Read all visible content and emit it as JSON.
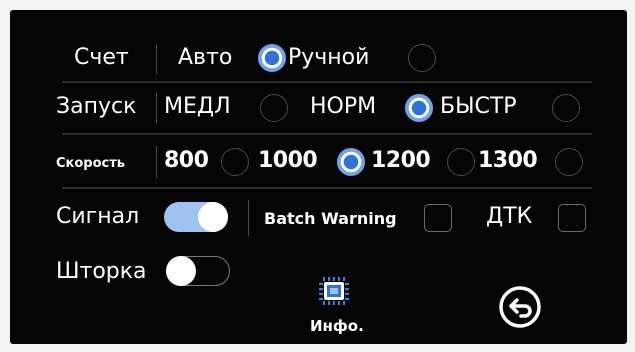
{
  "rows": {
    "count": {
      "label": "Счет",
      "options": [
        {
          "label": "Авто",
          "selected": true
        },
        {
          "label": "Ручной",
          "selected": false
        }
      ]
    },
    "start": {
      "label": "Запуск",
      "options": [
        {
          "label": "МЕДЛ",
          "selected": false
        },
        {
          "label": "НОРМ",
          "selected": true
        },
        {
          "label": "БЫСТР",
          "selected": false
        }
      ]
    },
    "speed": {
      "label": "Скорость",
      "options": [
        {
          "label": "800",
          "selected": false
        },
        {
          "label": "1000",
          "selected": true
        },
        {
          "label": "1200",
          "selected": false
        },
        {
          "label": "1300",
          "selected": false
        }
      ]
    },
    "signal": {
      "label": "Сигнал",
      "toggle_on": true,
      "batch_warning_label": "Batch Warning",
      "batch_warning_checked": false,
      "dtk_label": "ДТК",
      "dtk_checked": false
    },
    "curtain": {
      "label": "Шторка",
      "toggle_on": false
    }
  },
  "bottom": {
    "info_label": "Инфо.",
    "info_icon": "chip-icon",
    "back_icon": "return-icon"
  },
  "colors": {
    "screen_bg": "#050505",
    "accent": "#2f73d6",
    "accent_light": "#6fa4e8",
    "toggle_on": "#9ec3f0"
  }
}
